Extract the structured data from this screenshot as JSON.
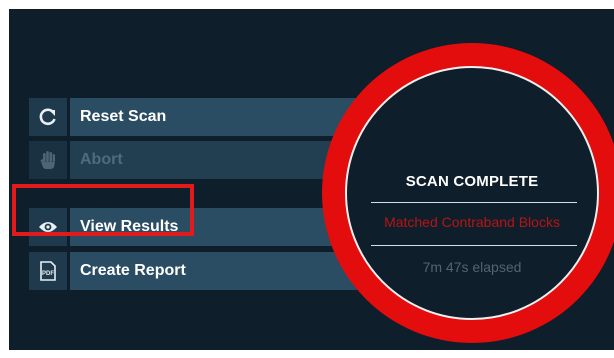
{
  "menu": {
    "items": [
      {
        "label": "Reset Scan",
        "icon": "refresh-icon",
        "enabled": true
      },
      {
        "label": "Abort",
        "icon": "hand-stop-icon",
        "enabled": false
      },
      {
        "label": "View Results",
        "icon": "eye-icon",
        "enabled": true,
        "highlighted": true
      },
      {
        "label": "Create Report",
        "icon": "pdf-icon",
        "enabled": true
      }
    ]
  },
  "status": {
    "title": "SCAN COMPLETE",
    "result": "Matched Contraband Blocks",
    "elapsed": "7m 47s elapsed"
  },
  "colors": {
    "background": "#0e1e2b",
    "button": "#2a4d63",
    "icon_cell": "#1f3a4d",
    "alert_red": "#e30d0d",
    "result_text": "#b81414"
  }
}
